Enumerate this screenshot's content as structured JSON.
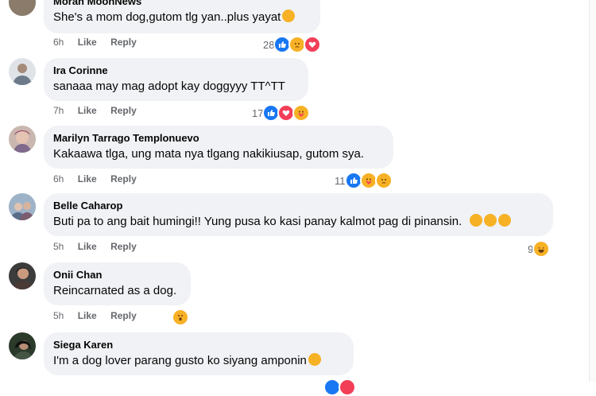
{
  "comments": [
    {
      "author": "Morah MoonNews",
      "text": "She's a mom dog,gutom tlg yan..plus yayat",
      "time": "6h",
      "like": "Like",
      "reply": "Reply",
      "reactions": "28",
      "reaction_icons": [
        "like-icon",
        "sad-icon",
        "love-icon"
      ]
    },
    {
      "author": "Ira Corinne",
      "text": "sanaaa may mag adopt kay doggyyy TT^TT",
      "time": "7h",
      "like": "Like",
      "reply": "Reply",
      "reactions": "17",
      "reaction_icons": [
        "like-icon",
        "love-icon",
        "care-icon"
      ]
    },
    {
      "author": "Marilyn Tarrago Templonuevo",
      "text": "Kakaawa tlga, ung mata nya tlgang nakikiusap, gutom sya.",
      "time": "6h",
      "like": "Like",
      "reply": "Reply",
      "reactions": "11",
      "reaction_icons": [
        "like-icon",
        "care-icon",
        "sad-icon"
      ]
    },
    {
      "author": "Belle Caharop",
      "text": "Buti pa to ang bait humingi!! Yung pusa ko kasi panay kalmot pag di pinansin.",
      "time": "5h",
      "like": "Like",
      "reply": "Reply",
      "reactions": "9",
      "reaction_icons": [
        "haha-icon"
      ]
    },
    {
      "author": "Onii Chan",
      "text": "Reincarnated as a dog.",
      "time": "5h",
      "like": "Like",
      "reply": "Reply",
      "reactions": "",
      "reaction_icons": [
        "wow-icon"
      ]
    },
    {
      "author": "Siega Karen",
      "text": "I'm a dog lover parang gusto ko siyang amponin",
      "time": "",
      "like": "",
      "reply": "",
      "reactions": "",
      "reaction_icons": []
    }
  ],
  "colors": {
    "bubble": "#f0f2f5",
    "like": "#1877f2",
    "love": "#f33e58",
    "emoji": "#f7b125",
    "meta": "#65676b"
  }
}
